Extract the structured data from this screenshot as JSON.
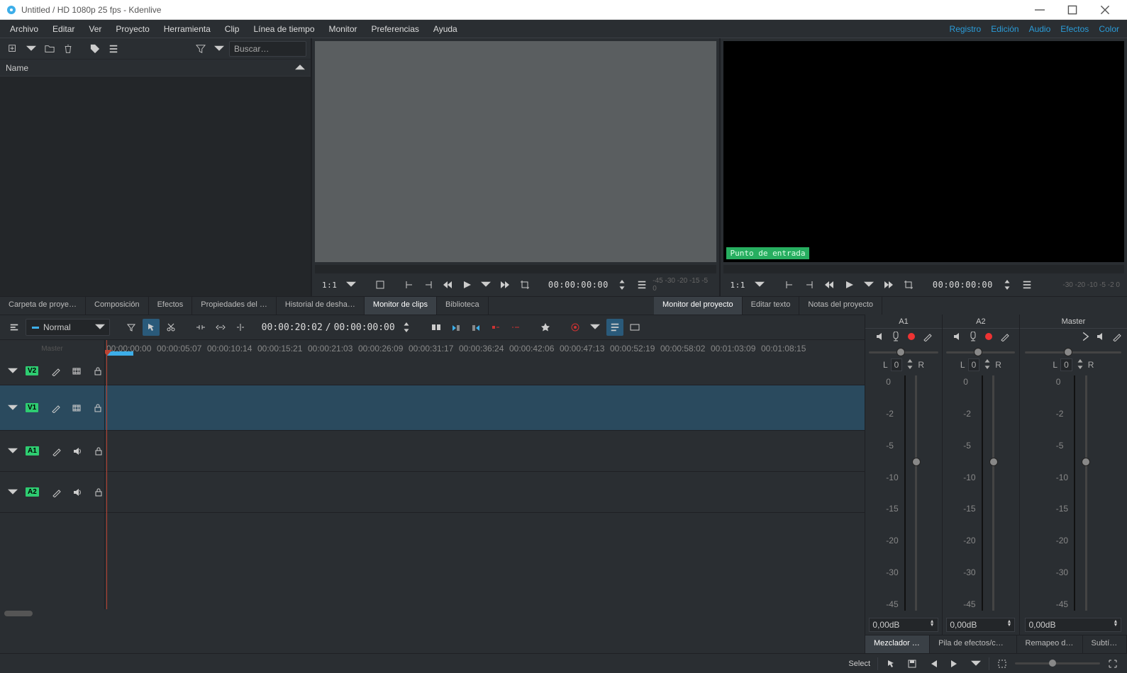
{
  "window": {
    "title": "Untitled / HD 1080p 25 fps - Kdenlive"
  },
  "menu": {
    "items": [
      "Archivo",
      "Editar",
      "Ver",
      "Proyecto",
      "Herramienta",
      "Clip",
      "Línea de tiempo",
      "Monitor",
      "Preferencias",
      "Ayuda"
    ],
    "right": [
      "Registro",
      "Edición",
      "Audio",
      "Efectos",
      "Color"
    ]
  },
  "bin": {
    "search_placeholder": "Buscar…",
    "header": "Name"
  },
  "clip_monitor": {
    "scale": "1:1",
    "timecode": "00:00:00:00",
    "db_readout": "-45  -30 -20 -15 -5  0"
  },
  "proj_monitor": {
    "scale": "1:1",
    "timecode": "00:00:00:00",
    "in_point_label": "Punto de entrada",
    "db_readout": "-30 -20  -10  -5 -2 0"
  },
  "tabs_left": [
    "Carpeta de proye…",
    "Composición",
    "Efectos",
    "Propiedades del …",
    "Historial de desha…",
    "Monitor de clips",
    "Biblioteca"
  ],
  "tabs_right": [
    "Monitor del proyecto",
    "Editar texto",
    "Notas del proyecto"
  ],
  "tl_toolbar": {
    "mode": "Normal",
    "position": "00:00:20:02",
    "duration": "00:00:00:00"
  },
  "timeline": {
    "ruler": [
      "00:00:00:00",
      "00:00:05:07",
      "00:00:10:14",
      "00:00:15:21",
      "00:00:21:03",
      "00:00:26:09",
      "00:00:31:17",
      "00:00:36:24",
      "00:00:42:06",
      "00:00:47:13",
      "00:00:52:19",
      "00:00:58:02",
      "00:01:03:09",
      "00:01:08:15"
    ],
    "tracks": [
      {
        "id": "V2",
        "type": "video"
      },
      {
        "id": "V1",
        "type": "video",
        "selected": true
      },
      {
        "id": "A1",
        "type": "audio"
      },
      {
        "id": "A2",
        "type": "audio"
      }
    ]
  },
  "mixer": {
    "channels": [
      {
        "name": "A1",
        "balance": "0",
        "db": "0,00dB"
      },
      {
        "name": "A2",
        "balance": "0",
        "db": "0,00dB"
      }
    ],
    "master": {
      "name": "Master",
      "balance": "0",
      "db": "0,00dB"
    },
    "scale": [
      "0",
      "-2",
      "-5",
      "-10",
      "-15",
      "-20",
      "-30",
      "-45"
    ],
    "L": "L",
    "R": "R"
  },
  "mixer_tabs": [
    "Mezclador de a…",
    "Pila de efectos/composi…",
    "Remapeo de tie…",
    "Subtítulos"
  ],
  "status": {
    "select": "Select"
  }
}
